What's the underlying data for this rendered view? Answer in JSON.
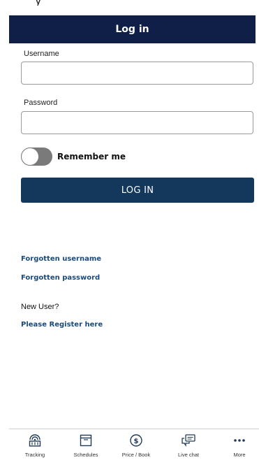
{
  "status_bar": {
    "carrier_text": "y"
  },
  "header": {
    "title": "Log in"
  },
  "form": {
    "username_label": "Username",
    "username_value": "",
    "password_label": "Password",
    "password_value": "",
    "remember_label": "Remember me",
    "remember_checked": false,
    "login_button": "LOG IN"
  },
  "links": {
    "forgot_username": "Forgotten username",
    "forgot_password": "Forgotten password",
    "new_user": "New User?",
    "register": "Please Register here"
  },
  "bottom_nav": {
    "items": [
      {
        "label": "Tracking",
        "icon": "tracking-icon"
      },
      {
        "label": "Schedules",
        "icon": "calendar-icon"
      },
      {
        "label": "Price / Book",
        "icon": "dollar-icon"
      },
      {
        "label": "Live chat",
        "icon": "chat-icon"
      },
      {
        "label": "More",
        "icon": "more-dots-icon"
      }
    ]
  },
  "colors": {
    "header_bg": "#0f1f47",
    "button_bg": "#14385c",
    "link": "#1a4a7a",
    "toggle_off": "#7a7a7a"
  }
}
